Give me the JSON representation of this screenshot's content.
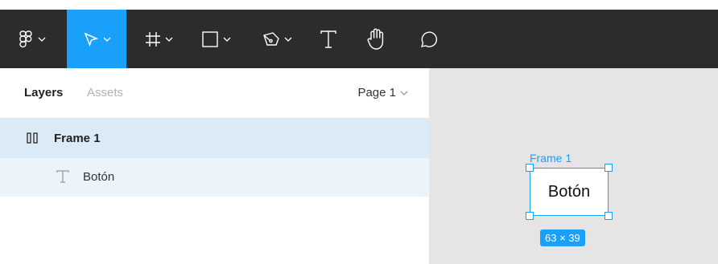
{
  "toolbar": {
    "tools": [
      {
        "icon": "figma-menu-icon",
        "has_menu": true,
        "active": false
      },
      {
        "icon": "move-cursor-icon",
        "has_menu": true,
        "active": true
      },
      {
        "icon": "frame-hash-icon",
        "has_menu": true,
        "active": false
      },
      {
        "icon": "rectangle-icon",
        "has_menu": true,
        "active": false
      },
      {
        "icon": "pen-icon",
        "has_menu": true,
        "active": false
      },
      {
        "icon": "text-tool-icon",
        "has_menu": false,
        "active": false
      },
      {
        "icon": "hand-icon",
        "has_menu": false,
        "active": false
      },
      {
        "icon": "comment-icon",
        "has_menu": false,
        "active": false
      }
    ],
    "active_color": "#18a0fb",
    "bg_color": "#2c2c2c"
  },
  "sidebar": {
    "tabs": {
      "layers": "Layers",
      "assets": "Assets"
    },
    "page_select": "Page 1",
    "layers": [
      {
        "label": "Frame 1",
        "icon": "frame-layer-icon",
        "selected": true
      },
      {
        "label": "Botón",
        "icon": "text-layer-icon",
        "selected": false
      }
    ]
  },
  "canvas": {
    "frame_label": "Frame 1",
    "button_text": "Botón",
    "size_badge": "63 × 39",
    "selection_color": "#18a0fb"
  }
}
